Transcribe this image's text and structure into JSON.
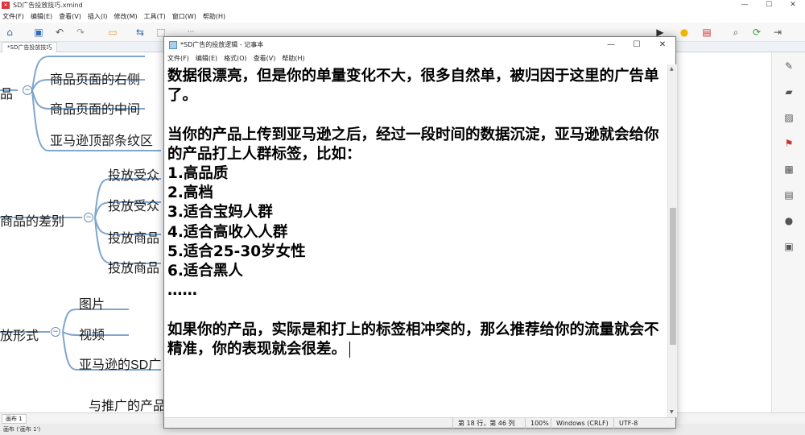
{
  "xmind": {
    "title": "SD广告投放技巧.xmind",
    "menu": [
      "文件(F)",
      "编辑(E)",
      "查看(V)",
      "插入(I)",
      "修改(M)",
      "工具(T)",
      "窗口(W)",
      "帮助(H)"
    ],
    "tab_label": "*SD广告投放技巧",
    "sheet_tab": "画布 1",
    "status_text": "画布 ('画布 1')",
    "toolbar_more": "···",
    "nodes": {
      "n1": "品",
      "n2": "商品页面的右侧",
      "n3": "商品页面的中间",
      "n4": "亚马逊顶部条纹区",
      "n5": "商品的差别",
      "n6": "投放受众",
      "n7": "投放受众",
      "n8": "投放商品",
      "n9": "投放商品",
      "n10": "放形式",
      "n11": "图片",
      "n12": "视频",
      "n13": "亚马逊的SD广",
      "n14": "与推广的产品"
    }
  },
  "notepad": {
    "title": "*SD广告的投放逻辑 - 记事本",
    "menu": [
      "文件(F)",
      "编辑(E)",
      "格式(O)",
      "查看(V)",
      "帮助(H)"
    ],
    "content": "数据很漂亮，但是你的单量变化不大，很多自然单，被归因于这里的广告单了。\n\n当你的产品上传到亚马逊之后，经过一段时间的数据沉淀，亚马逊就会给你的产品打上人群标签，比如：\n1.高品质\n2.高档\n3.适合宝妈人群\n4.适合高收入人群\n5.适合25-30岁女性\n6.适合黑人\n……\n\n如果你的产品，实际是和打上的标签相冲突的，那么推荐给你的流量就会不精准，你的表现就会很差。",
    "status": {
      "position": "第 18 行，第 46 列",
      "zoom": "100%",
      "line_ending": "Windows (CRLF)",
      "encoding": "UTF-8"
    }
  }
}
